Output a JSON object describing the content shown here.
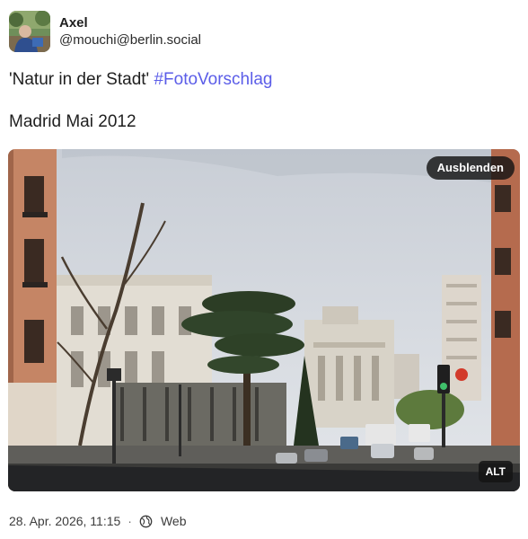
{
  "post": {
    "author": {
      "display_name": "Axel",
      "handle": "@mouchi@berlin.social",
      "avatar_icon": "user-avatar-photo"
    },
    "content": {
      "title_text": "'Natur in der Stadt'",
      "hashtag": "#FotoVorschlag",
      "line2": "Madrid Mai 2012"
    },
    "media": {
      "hide_label": "Ausblenden",
      "alt_label": "ALT"
    },
    "meta": {
      "timestamp": "28. Apr. 2026, 11:15",
      "separator": "·",
      "visibility_icon": "globe-icon",
      "client": "Web"
    }
  },
  "colors": {
    "hashtag": "#5b5de8",
    "badge_bg": "#141414",
    "text": "#1f1f1f"
  }
}
